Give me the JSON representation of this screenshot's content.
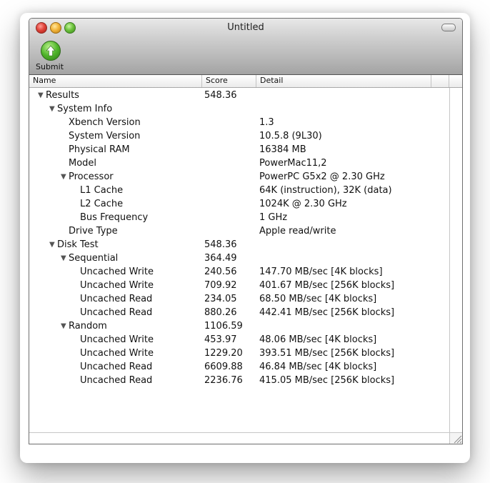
{
  "window": {
    "title": "Untitled"
  },
  "toolbar": {
    "submit_label": "Submit"
  },
  "columns": {
    "name": "Name",
    "score": "Score",
    "detail": "Detail"
  },
  "rows": [
    {
      "name": "Results",
      "score": "548.36",
      "detail": "",
      "level": 0,
      "expanded": true
    },
    {
      "name": "System Info",
      "score": "",
      "detail": "",
      "level": 1,
      "expanded": true
    },
    {
      "name": "Xbench Version",
      "score": "",
      "detail": "1.3",
      "level": 2
    },
    {
      "name": "System Version",
      "score": "",
      "detail": "10.5.8 (9L30)",
      "level": 2
    },
    {
      "name": "Physical RAM",
      "score": "",
      "detail": "16384 MB",
      "level": 2
    },
    {
      "name": "Model",
      "score": "",
      "detail": "PowerMac11,2",
      "level": 2
    },
    {
      "name": "Processor",
      "score": "",
      "detail": "PowerPC G5x2 @ 2.30 GHz",
      "level": 2,
      "expanded": true
    },
    {
      "name": "L1 Cache",
      "score": "",
      "detail": "64K (instruction), 32K (data)",
      "level": 3
    },
    {
      "name": "L2 Cache",
      "score": "",
      "detail": "1024K @ 2.30 GHz",
      "level": 3
    },
    {
      "name": "Bus Frequency",
      "score": "",
      "detail": "1 GHz",
      "level": 3
    },
    {
      "name": "Drive Type",
      "score": "",
      "detail": "Apple read/write",
      "level": 2
    },
    {
      "name": "Disk Test",
      "score": "548.36",
      "detail": "",
      "level": 1,
      "expanded": true
    },
    {
      "name": "Sequential",
      "score": "364.49",
      "detail": "",
      "level": 2,
      "expanded": true
    },
    {
      "name": "Uncached Write",
      "score": "240.56",
      "detail": "147.70 MB/sec [4K blocks]",
      "level": 3
    },
    {
      "name": "Uncached Write",
      "score": "709.92",
      "detail": "401.67 MB/sec [256K blocks]",
      "level": 3
    },
    {
      "name": "Uncached Read",
      "score": "234.05",
      "detail": "68.50 MB/sec [4K blocks]",
      "level": 3
    },
    {
      "name": "Uncached Read",
      "score": "880.26",
      "detail": "442.41 MB/sec [256K blocks]",
      "level": 3
    },
    {
      "name": "Random",
      "score": "1106.59",
      "detail": "",
      "level": 2,
      "expanded": true
    },
    {
      "name": "Uncached Write",
      "score": "453.97",
      "detail": "48.06 MB/sec [4K blocks]",
      "level": 3
    },
    {
      "name": "Uncached Write",
      "score": "1229.20",
      "detail": "393.51 MB/sec [256K blocks]",
      "level": 3
    },
    {
      "name": "Uncached Read",
      "score": "6609.88",
      "detail": "46.84 MB/sec [4K blocks]",
      "level": 3
    },
    {
      "name": "Uncached Read",
      "score": "2236.76",
      "detail": "415.05 MB/sec [256K blocks]",
      "level": 3
    }
  ],
  "icons": {
    "close": "close-icon",
    "minimize": "minimize-icon",
    "zoom": "zoom-icon",
    "toolbar_toggle": "toolbar-toggle-icon",
    "submit": "upload-arrow-icon"
  }
}
